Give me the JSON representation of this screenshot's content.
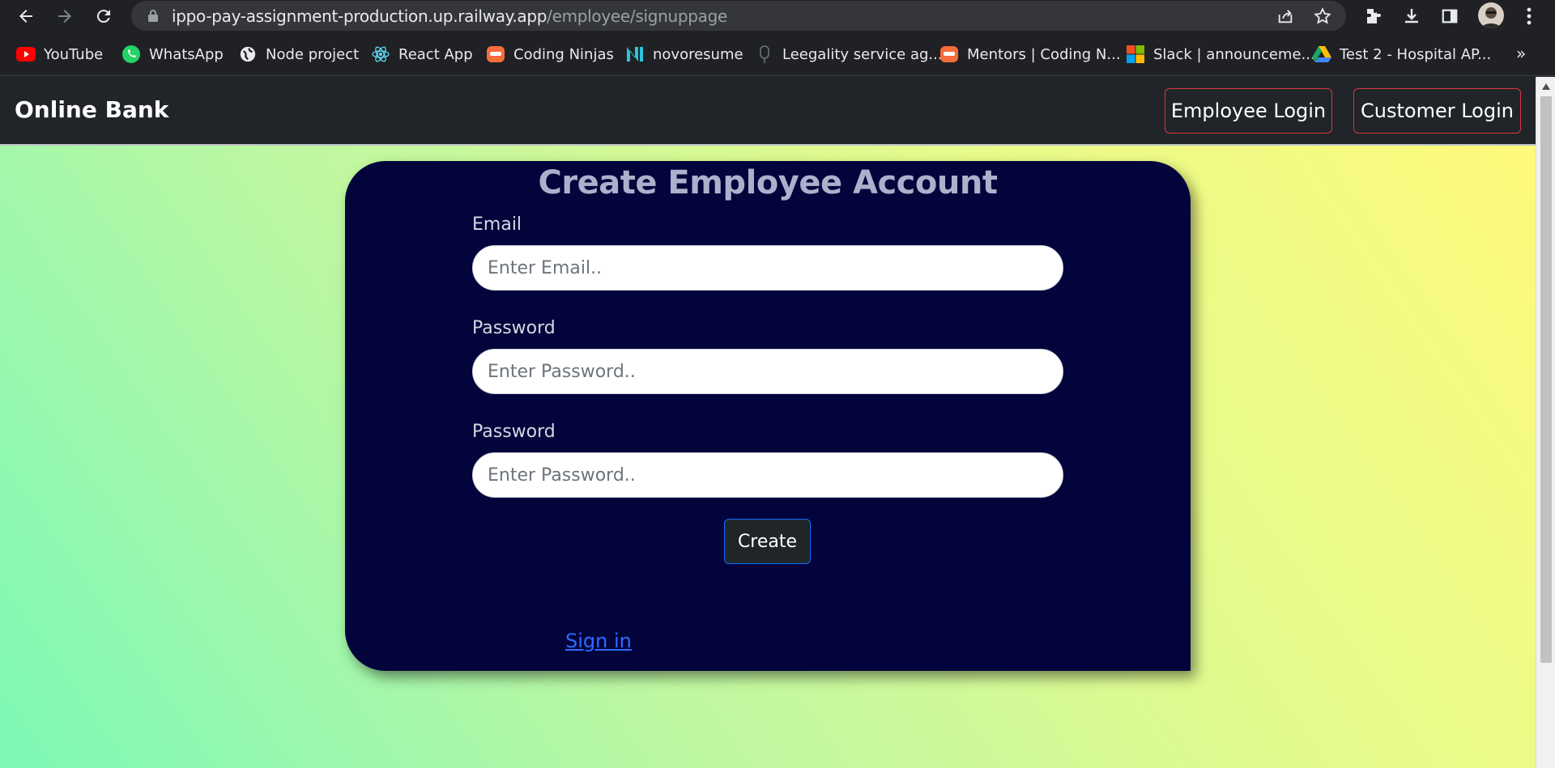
{
  "browser": {
    "url_host": "ippo-pay-assignment-production.up.railway.app",
    "url_path": "/employee/signuppage",
    "bookmarks": [
      {
        "label": "YouTube",
        "icon": "youtube-icon",
        "color": "#ff0000"
      },
      {
        "label": "WhatsApp",
        "icon": "whatsapp-icon",
        "color": "#25d366"
      },
      {
        "label": "Node project",
        "icon": "globe-icon",
        "color": "#e8eaed"
      },
      {
        "label": "React App",
        "icon": "react-icon",
        "color": "#61dafb"
      },
      {
        "label": "Coding Ninjas",
        "icon": "coding-ninjas-icon",
        "color": "#f66c3b"
      },
      {
        "label": "novoresume",
        "icon": "novoresume-icon",
        "color": "#2ec4d6"
      },
      {
        "label": "Leegality service ag...",
        "icon": "leegality-icon",
        "color": "#9aa0a6"
      },
      {
        "label": "Mentors | Coding N...",
        "icon": "coding-ninjas-icon",
        "color": "#f66c3b"
      },
      {
        "label": "Slack | announceme...",
        "icon": "microsoft-icon",
        "color": "#f25022"
      },
      {
        "label": "Test 2 - Hospital AP...",
        "icon": "google-drive-icon",
        "color": "#1fa463"
      }
    ],
    "more_bookmarks": "»"
  },
  "navbar": {
    "brand": "Online Bank",
    "employee_login": "Employee Login",
    "customer_login": "Customer Login",
    "accent": "#dc3545"
  },
  "form": {
    "title": "Create Employee Account",
    "email_label": "Email",
    "email_placeholder": "Enter Email..",
    "password_label": "Password",
    "password_placeholder": "Enter Password..",
    "confirm_label": "Password",
    "confirm_placeholder": "Enter Password..",
    "create_label": "Create",
    "signin_link": "Sign in"
  },
  "colors": {
    "card_bg": "#02043b",
    "navbar_bg": "#212529",
    "link": "#2f6bff",
    "button_border": "#0d6efd"
  }
}
